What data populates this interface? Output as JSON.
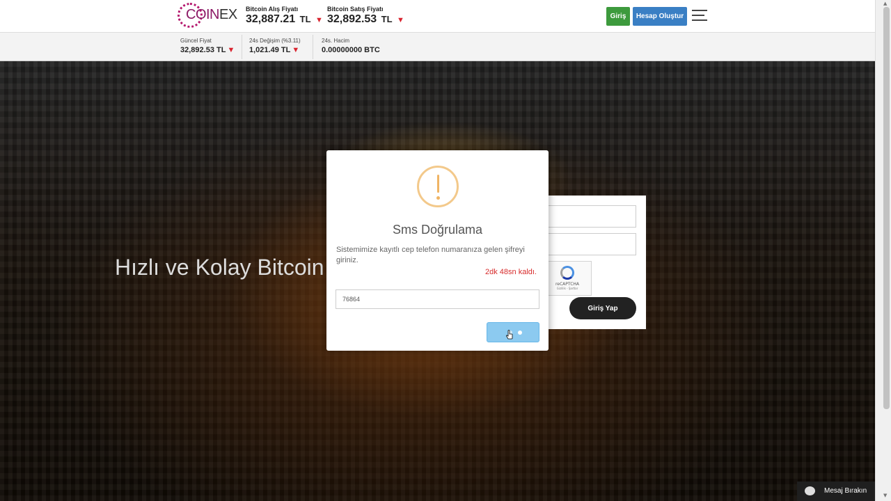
{
  "header": {
    "logo_coin": "COIN",
    "logo_ex": "EX",
    "buy_price_label": "Bitcoin Alış Fiyatı",
    "buy_price_value": "32,887.21",
    "sell_price_label": "Bitcoin Satış Fiyatı",
    "sell_price_value": "32,892.53",
    "currency": "TL",
    "login_label": "Giriş",
    "register_label": "Hesap Oluştur"
  },
  "stats": [
    {
      "label": "Güncel Fiyat",
      "value": "32,892.53 TL",
      "trend": "down"
    },
    {
      "label": "24s Değişim (%3.11)",
      "value": "1,021.49 TL",
      "trend": "down"
    },
    {
      "label": "24s. Hacim",
      "value": "0.00000000 BTC"
    }
  ],
  "hero": {
    "title": "Hızlı ve Kolay Bitcoin"
  },
  "login_card": {
    "recaptcha_label": "reCAPTCHA",
    "recaptcha_links": "Gizlilik - Şartlar",
    "submit_label": "Giriş Yap"
  },
  "modal": {
    "title": "Sms Doğrulama",
    "message": "Sistemimize kayıtlı cep telefon numaranıza gelen şifreyi giriniz.",
    "countdown": "2dk 48sn kaldı.",
    "code_value": "76864",
    "confirm_state": "loading"
  },
  "chat": {
    "label": "Mesaj Bırakın"
  },
  "colors": {
    "brand": "#8c1a66",
    "login_green": "#3d9a3d",
    "register_blue": "#3a7fc4",
    "trend_down": "#d9242f",
    "warning": "#f0b464",
    "countdown_red": "#d72b2b",
    "confirm_button": "#8ccaf0"
  }
}
